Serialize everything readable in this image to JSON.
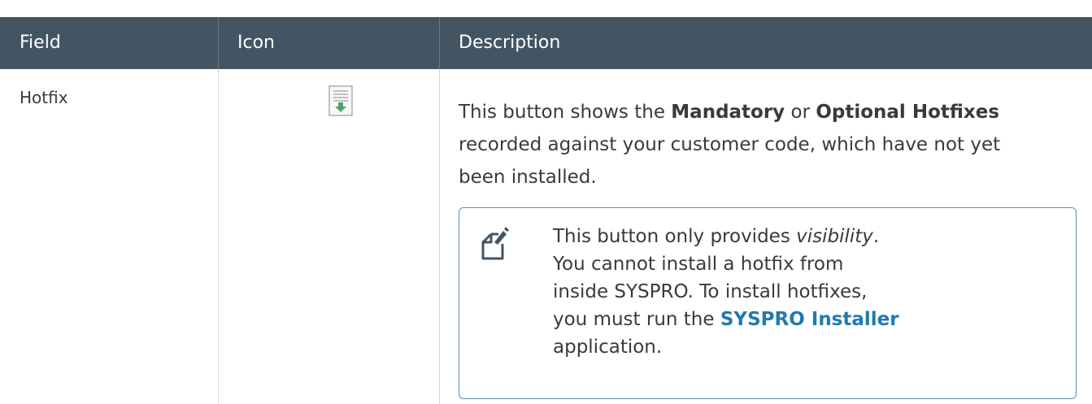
{
  "table": {
    "headers": {
      "field": "Field",
      "icon": "Icon",
      "description": "Description"
    },
    "row": {
      "field": "Hotfix",
      "icon": "hotfix-download-icon",
      "description": {
        "line1_a": "This button shows the ",
        "line1_b": "Mandatory",
        "line1_c": " or ",
        "line1_d": "Optional Hotfixes",
        "line2": "recorded against your customer code, which have not yet",
        "line3": "been installed."
      },
      "note": {
        "icon": "note-pencil-icon",
        "line1_a": "This button only provides ",
        "line1_b": "visibility",
        "line1_c": ".",
        "line2": "You cannot install a hotfix from",
        "line3": "inside SYSPRO. To install hotfixes,",
        "line4_a": "you must run the ",
        "line4_b": "SYSPRO Installer",
        "line5": "application."
      }
    }
  },
  "colors": {
    "header_bg": "#435563",
    "link": "#1f7bb0",
    "note_border": "#5c8fb0",
    "icon_green": "#4aa36b"
  }
}
